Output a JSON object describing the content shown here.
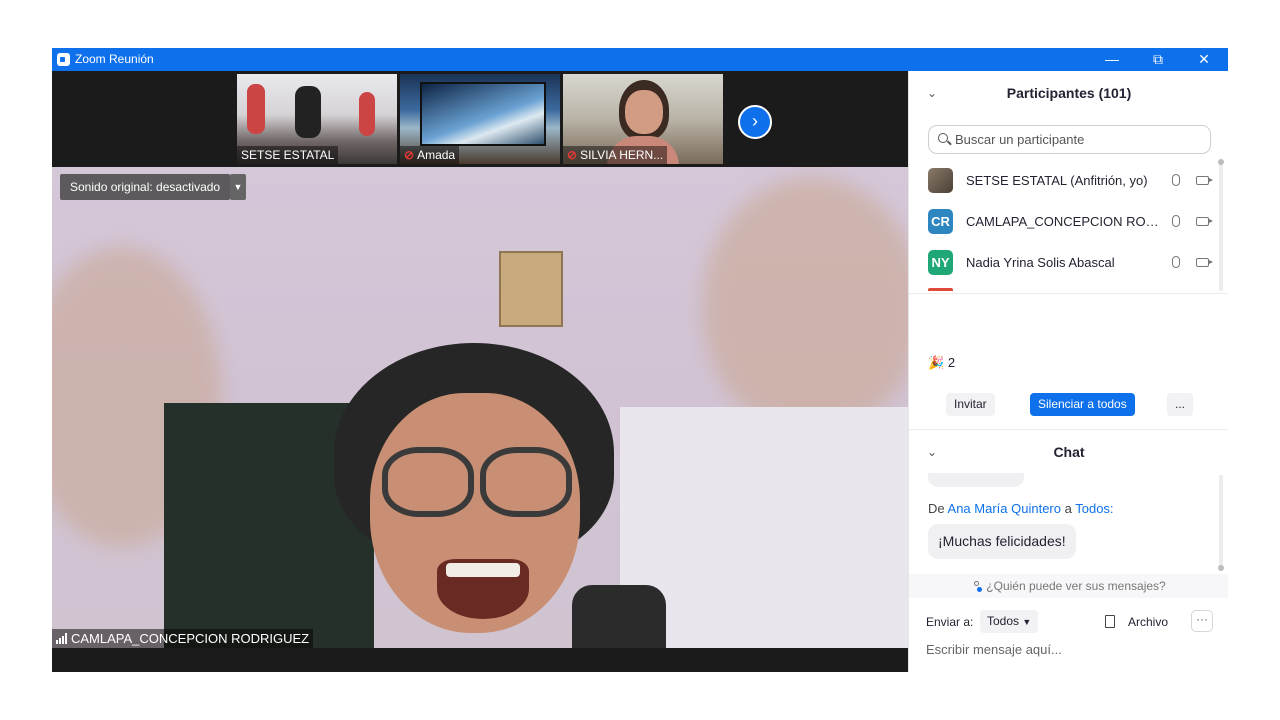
{
  "window": {
    "title": "Zoom Reunión",
    "minimize_icon": "minimize-icon",
    "restore_icon": "restore-icon",
    "close_icon": "close-icon",
    "brand_color": "#0e71eb"
  },
  "thumbnails": [
    {
      "name": "SETSE ESTATAL",
      "muted": false
    },
    {
      "name": "Amada",
      "muted": true
    },
    {
      "name": "SILVIA HERN...",
      "muted": true
    }
  ],
  "thumb_next_icon": "chevron-right-icon",
  "main_video": {
    "sound_original": "Sonido original: desactivado",
    "speaker_name": "CAMLAPA_CONCEPCION RODRIGUEZ"
  },
  "participants": {
    "title": "Participantes (101)",
    "search_placeholder": "Buscar un participante",
    "list": [
      {
        "name": "SETSE ESTATAL (Anfitrión, yo)",
        "initials": "",
        "color": "#6b5a4a"
      },
      {
        "name": "CAMLAPA_CONCEPCION RODRI...",
        "initials": "CR",
        "color": "#2e86c1"
      },
      {
        "name": "Nadia Yrina Solis Abascal",
        "initials": "NY",
        "color": "#1fa876"
      }
    ],
    "reaction_count": "2",
    "invite_label": "Invitar",
    "mute_all_label": "Silenciar a todos",
    "more_label": "..."
  },
  "chat": {
    "title": "Chat",
    "from_prefix": "De",
    "from_name": "Ana María Quintero",
    "from_mid": "a",
    "to_name": "Todos:",
    "message": "¡Muchas felicidades!",
    "who_can_see": "¿Quién puede ver sus mensajes?",
    "send_to_label": "Enviar a:",
    "send_to_value": "Todos",
    "file_label": "Archivo",
    "more_label": "···",
    "input_placeholder": "Escribir mensaje aquí..."
  }
}
